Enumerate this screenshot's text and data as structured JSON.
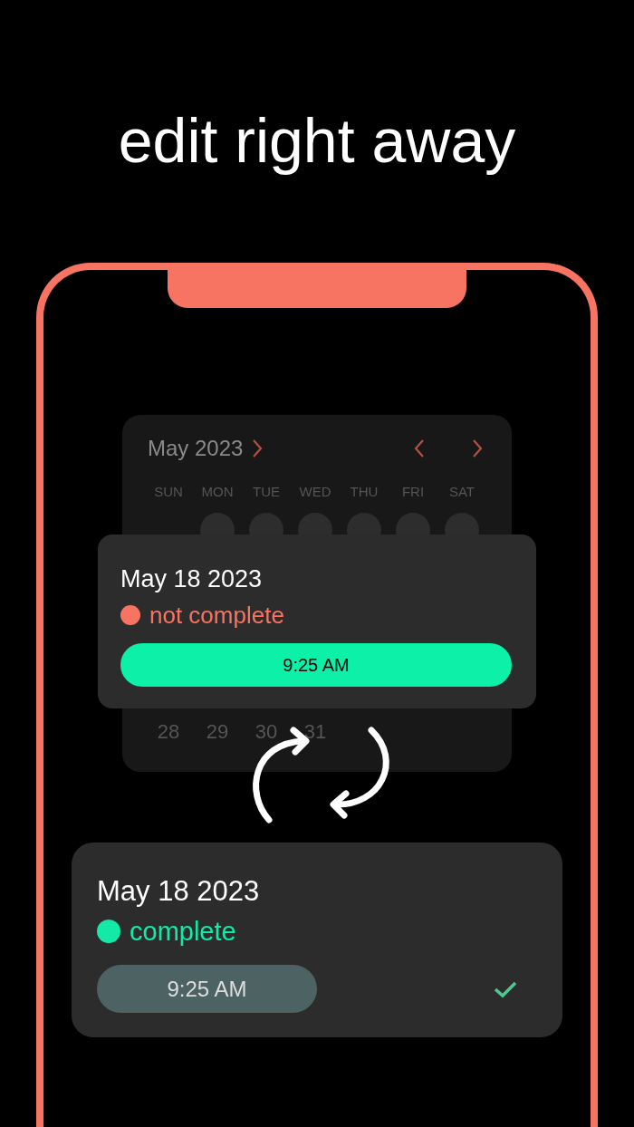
{
  "headline": "edit right away",
  "calendar": {
    "month": "May 2023",
    "weekdays": [
      "SUN",
      "MON",
      "TUE",
      "WED",
      "THU",
      "FRI",
      "SAT"
    ],
    "week_rows": [
      {
        "days": [
          {
            "marked": true
          },
          {
            "marked": true
          },
          {
            "marked": true
          },
          {
            "marked": true
          },
          {
            "marked": true
          },
          {
            "marked": true
          }
        ]
      },
      {
        "days": [
          {
            "label": "28",
            "marked": false
          },
          {
            "label": "29",
            "marked": false
          },
          {
            "label": "30",
            "marked": false
          },
          {
            "label": "31",
            "marked": false
          }
        ]
      }
    ]
  },
  "cards": [
    {
      "date": "May 18 2023",
      "status": "not complete",
      "complete": false,
      "color": "#f87462",
      "time": "9:25 AM"
    },
    {
      "date": "May 18 2023",
      "status": "complete",
      "complete": true,
      "color": "#14eaa7",
      "time": "9:25 AM"
    }
  ]
}
